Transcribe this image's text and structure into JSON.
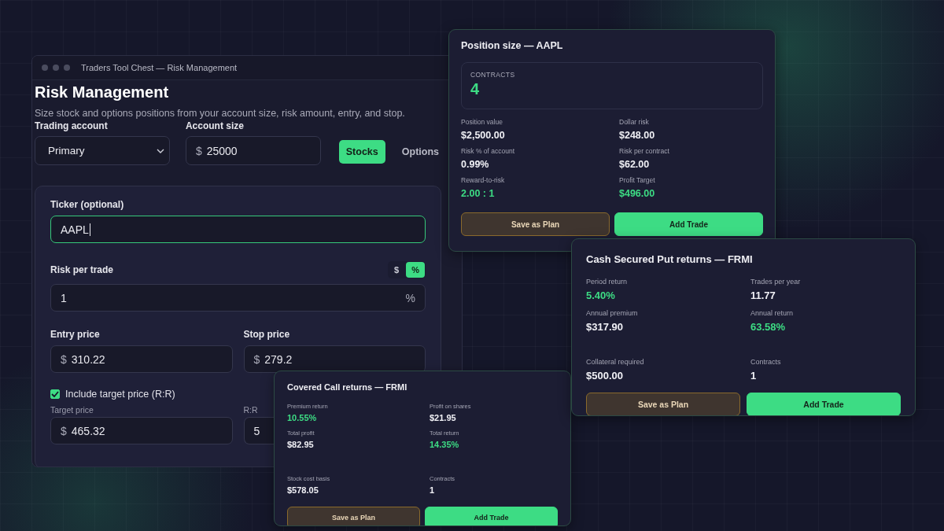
{
  "window": {
    "title": "Traders Tool Chest — Risk Management",
    "heading": "Risk Management",
    "subtitle": "Size stock and options positions from your account size, risk amount, entry, and stop."
  },
  "trading_account": {
    "label": "Trading account",
    "value": "Primary"
  },
  "account_size": {
    "label": "Account size",
    "currency": "$",
    "value": "25000"
  },
  "mode_tabs": [
    {
      "label": "Stocks",
      "selected": true
    },
    {
      "label": "Options",
      "selected": false
    }
  ],
  "ticker": {
    "label": "Ticker (optional)",
    "value": "AAPL",
    "focused": true
  },
  "risk": {
    "label": "Risk per trade",
    "units": [
      {
        "label": "$",
        "selected": false
      },
      {
        "label": "%",
        "selected": true
      }
    ],
    "value": "1",
    "suffix": "%"
  },
  "entry_price": {
    "label": "Entry price",
    "currency": "$",
    "value": "310.22"
  },
  "stop_price": {
    "label": "Stop price",
    "currency": "$",
    "value": "279.2"
  },
  "target_toggle": {
    "label": "Include target price (R:R)",
    "checked": true
  },
  "target_price": {
    "label": "Target price",
    "currency": "$",
    "value": "465.32"
  },
  "rr": {
    "label": "R:R",
    "value": "5"
  },
  "cards": [
    {
      "title": "Position size — AAPL",
      "highlight": {
        "label": "CONTRACTS",
        "value": "4"
      },
      "groups": [
        [
          {
            "label": "Position value",
            "value": "$2,500.00",
            "positive": false
          },
          {
            "label": "Dollar risk",
            "value": "$248.00",
            "positive": false
          },
          {
            "label": "Risk % of account",
            "value": "0.99%",
            "positive": false
          },
          {
            "label": "Risk per contract",
            "value": "$62.00",
            "positive": false
          },
          {
            "label": "Reward-to-risk",
            "value": "2.00 : 1",
            "positive": true
          },
          {
            "label": "Profit Target",
            "value": "$496.00",
            "positive": true
          }
        ]
      ],
      "buttons": [
        {
          "label": "Save as Plan",
          "kind": "plan"
        },
        {
          "label": "Add Trade",
          "kind": "primary"
        }
      ]
    },
    {
      "title": "Covered Call returns — FRMI",
      "groups": [
        [
          {
            "label": "Premium return",
            "value": "10.55%",
            "positive": true
          },
          {
            "label": "Profit on shares",
            "value": "$21.95",
            "positive": false
          },
          {
            "label": "Total profit",
            "value": "$82.95",
            "positive": false
          },
          {
            "label": "Total return",
            "value": "14.35%",
            "positive": true
          }
        ],
        [
          {
            "label": "Stock cost basis",
            "value": "$578.05",
            "positive": false
          },
          {
            "label": "Contracts",
            "value": "1",
            "positive": false
          }
        ]
      ],
      "buttons": [
        {
          "label": "Save as Plan",
          "kind": "plan"
        },
        {
          "label": "Add Trade",
          "kind": "primary"
        }
      ]
    },
    {
      "title": "Cash Secured Put returns — FRMI",
      "groups": [
        [
          {
            "label": "Period return",
            "value": "5.40%",
            "positive": true
          },
          {
            "label": "Trades per year",
            "value": "11.77",
            "positive": false
          },
          {
            "label": "Annual premium",
            "value": "$317.90",
            "positive": false
          },
          {
            "label": "Annual return",
            "value": "63.58%",
            "positive": true
          }
        ],
        [
          {
            "label": "Collateral required",
            "value": "$500.00",
            "positive": false
          },
          {
            "label": "Contracts",
            "value": "1",
            "positive": false
          }
        ]
      ],
      "buttons": [
        {
          "label": "Save as Plan",
          "kind": "plan"
        },
        {
          "label": "Add Trade",
          "kind": "primary"
        }
      ]
    }
  ]
}
